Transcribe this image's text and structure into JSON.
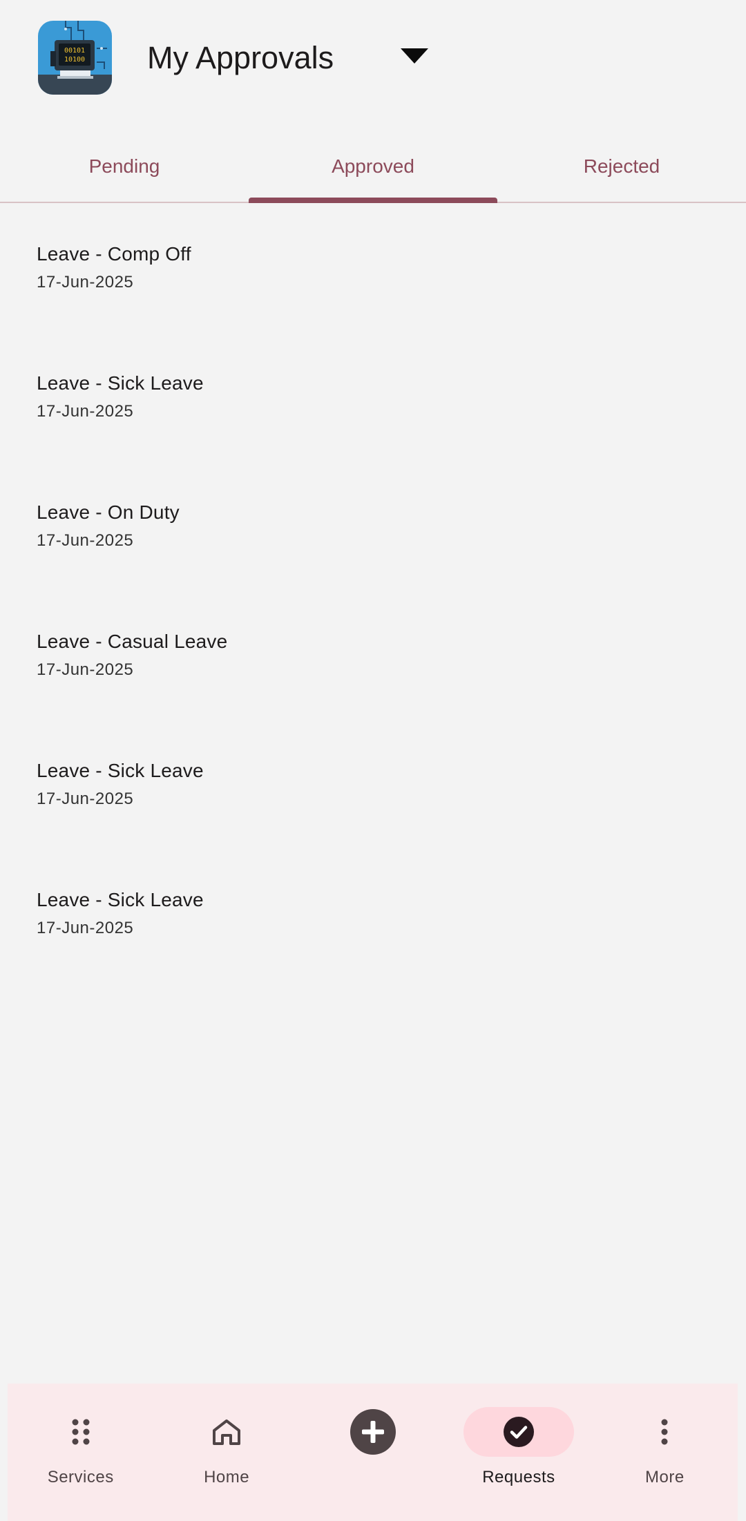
{
  "header": {
    "title": "My Approvals",
    "app_icon": "computer-circuit-app-icon",
    "dropdown_icon": "dropdown-arrow-icon"
  },
  "tabs": [
    {
      "label": "Pending",
      "active": false
    },
    {
      "label": "Approved",
      "active": true
    },
    {
      "label": "Rejected",
      "active": false
    }
  ],
  "list": {
    "items": [
      {
        "title": "Leave - Comp Off",
        "date": "17-Jun-2025"
      },
      {
        "title": "Leave - Sick Leave",
        "date": "17-Jun-2025"
      },
      {
        "title": "Leave - On Duty",
        "date": "17-Jun-2025"
      },
      {
        "title": "Leave - Casual Leave",
        "date": "17-Jun-2025"
      },
      {
        "title": "Leave - Sick Leave",
        "date": "17-Jun-2025"
      },
      {
        "title": "Leave - Sick Leave",
        "date": "17-Jun-2025"
      }
    ]
  },
  "bottom_nav": {
    "items": [
      {
        "label": "Services",
        "icon": "grid-dots-icon",
        "active": false
      },
      {
        "label": "Home",
        "icon": "home-icon",
        "active": false
      },
      {
        "label": "",
        "icon": "add-circle-icon",
        "active": false
      },
      {
        "label": "Requests",
        "icon": "check-circle-icon",
        "active": true
      },
      {
        "label": "More",
        "icon": "more-vertical-icon",
        "active": false
      }
    ]
  },
  "colors": {
    "accent": "#8c4a5a",
    "background": "#f3f3f3",
    "nav_background": "#faeaec",
    "nav_active_pill": "#fed7dd"
  }
}
